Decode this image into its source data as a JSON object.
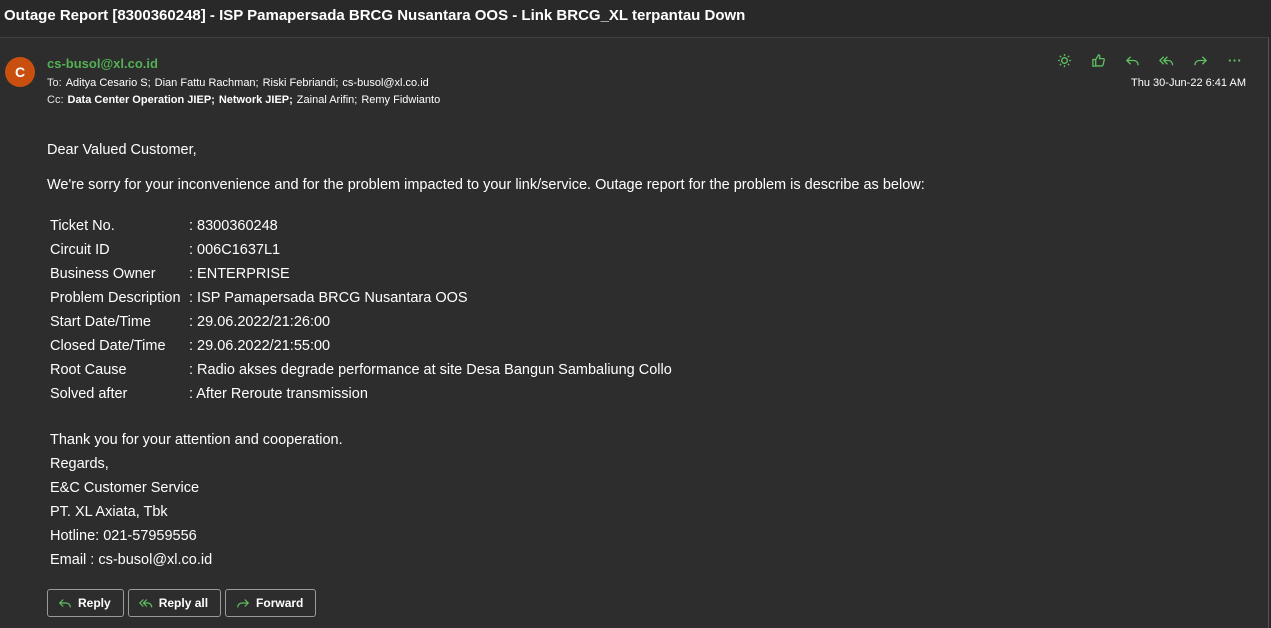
{
  "email": {
    "subject": "Outage Report [8300360248] - ISP Pamapersada BRCG Nusantara OOS - Link BRCG_XL terpantau Down",
    "avatar_initial": "C",
    "sender": "cs-busol@xl.co.id",
    "to_label": "To:",
    "to": [
      {
        "name": "Aditya Cesario S;",
        "bold": false
      },
      {
        "name": "Dian Fattu Rachman;",
        "bold": false
      },
      {
        "name": "Riski Febriandi;",
        "bold": false
      },
      {
        "name": "cs-busol@xl.co.id",
        "bold": false
      }
    ],
    "cc_label": "Cc:",
    "cc": [
      {
        "name": "Data Center Operation JIEP;",
        "bold": true
      },
      {
        "name": "Network JIEP;",
        "bold": true
      },
      {
        "name": "Zainal Arifin;",
        "bold": false
      },
      {
        "name": "Remy Fidwianto",
        "bold": false
      }
    ],
    "date": "Thu 30-Jun-22 6:41 AM"
  },
  "toolbar": {
    "icons": [
      "sun-icon",
      "thumbs-up-icon",
      "reply-icon",
      "reply-all-icon",
      "forward-icon",
      "more-icon"
    ]
  },
  "body": {
    "greeting": "Dear Valued Customer,",
    "intro": "We're sorry for your inconvenience and for the problem impacted to your link/service. Outage report for the problem is describe as below:",
    "details": [
      {
        "key": "Ticket No.",
        "value": ": 8300360248"
      },
      {
        "key": "Circuit ID",
        "value": ": 006C1637L1"
      },
      {
        "key": "Business Owner",
        "value": ": ENTERPRISE"
      },
      {
        "key": "Problem Description",
        "value": ": ISP Pamapersada BRCG Nusantara OOS"
      },
      {
        "key": "Start Date/Time",
        "value": ": 29.06.2022/21:26:00"
      },
      {
        "key": "Closed Date/Time",
        "value": ": 29.06.2022/21:55:00"
      },
      {
        "key": "Root Cause",
        "value": ": Radio akses degrade performance at site Desa Bangun Sambaliung Collo"
      },
      {
        "key": "Solved after",
        "value": ": After Reroute transmission"
      }
    ],
    "signature": [
      "Thank you for your attention and cooperation.",
      "Regards,",
      "E&C Customer Service",
      "PT. XL Axiata, Tbk",
      "Hotline: 021-57959556",
      "Email : cs-busol@xl.co.id"
    ]
  },
  "actions": {
    "reply": "Reply",
    "reply_all": "Reply all",
    "forward": "Forward"
  },
  "colors": {
    "accent": "#5fbf5f",
    "sender": "#54b054",
    "avatar": "#c94f0f",
    "background": "#2d2d2d"
  }
}
